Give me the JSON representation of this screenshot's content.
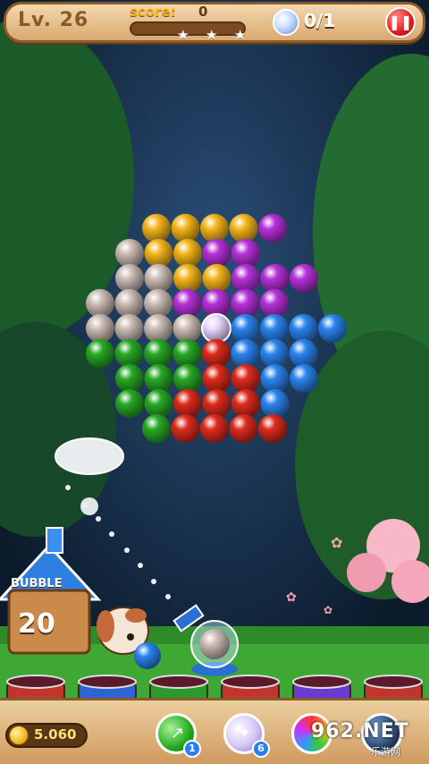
{
  "hud": {
    "level_label": "Lv. 26",
    "score_label": "score:",
    "score_value": "0",
    "score_progress": 0,
    "target_text": "0/1",
    "pause_icon": "pause-icon"
  },
  "house": {
    "sign": "BUBBLE",
    "remaining_shots": "20"
  },
  "bottom": {
    "coins": "5.060",
    "booster_green_count": "1",
    "booster_white_count": "6",
    "watermark": "962.NET",
    "watermark_sub": "乐游网"
  },
  "colors": {
    "yellow": "#f3b51a",
    "purple": "#b531d8",
    "white": "#cbbbb3",
    "blue": "#2a84ee",
    "green": "#27a825",
    "red": "#dd2b1c"
  },
  "bubble_grid": [
    [
      "yellow",
      "yellow",
      "yellow",
      "yellow",
      "purple"
    ],
    [
      "white",
      "yellow",
      "yellow",
      "purple",
      "purple"
    ],
    [
      "white",
      "white",
      "yellow",
      "yellow",
      "purple",
      "purple",
      "purple"
    ],
    [
      "white",
      "white",
      "white",
      "purple",
      "purple",
      "purple",
      "purple"
    ],
    [
      "white",
      "white",
      "white",
      "white",
      "special",
      "blue",
      "blue",
      "blue",
      "blue"
    ],
    [
      "green",
      "green",
      "green",
      "green",
      "red",
      "blue",
      "blue",
      "blue"
    ],
    [
      "green",
      "green",
      "green",
      "red",
      "red",
      "blue",
      "blue"
    ],
    [
      "green",
      "green",
      "red",
      "red",
      "red",
      "blue"
    ],
    [
      "green",
      "red",
      "red",
      "red",
      "red"
    ]
  ],
  "shooter": {
    "next_bubble": "blue",
    "loaded_bubble": "white"
  }
}
